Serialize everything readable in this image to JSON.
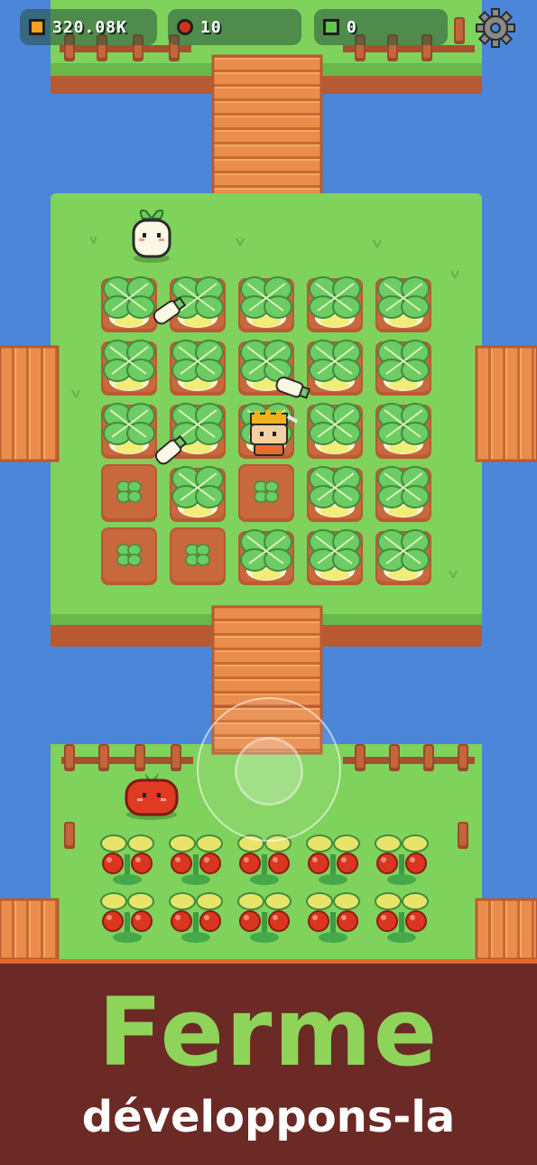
{
  "hud": {
    "coins": {
      "icon": "coin-icon",
      "value": "320.08K",
      "color": "#f2a11c"
    },
    "gems": {
      "icon": "tomato-gem-icon",
      "value": "10",
      "color": "#d3321e"
    },
    "seeds": {
      "icon": "green-gem-icon",
      "value": "0",
      "color": "#63c64c"
    },
    "settings": {
      "icon": "gear-icon"
    }
  },
  "banner": {
    "title": "Ferme",
    "subtitle": "développons-la",
    "background": "#6b2a25",
    "title_color": "#8ed45a"
  },
  "farm": {
    "turnip_field": {
      "rows": [
        [
          "turnip",
          "turnip",
          "turnip",
          "turnip",
          "turnip"
        ],
        [
          "turnip",
          "turnip",
          "turnip",
          "turnip",
          "turnip"
        ],
        [
          "turnip",
          "turnip",
          "turnip",
          "turnip",
          "turnip"
        ],
        [
          "sprout",
          "turnip",
          "sprout",
          "turnip",
          "turnip"
        ],
        [
          "sprout",
          "sprout",
          "turnip",
          "turnip",
          "turnip"
        ]
      ]
    },
    "tomato_field": {
      "rows": [
        [
          "tomato",
          "tomato",
          "tomato",
          "tomato",
          "tomato"
        ],
        [
          "tomato",
          "tomato",
          "tomato",
          "tomato",
          "tomato"
        ]
      ]
    },
    "colors": {
      "water": "#4b86d8",
      "grass": "#7fd25b",
      "soil": "#c8623a",
      "bridge": "#e98a4a",
      "leaf": "#68c860"
    }
  },
  "joystick": {
    "icon": "joystick-icon"
  }
}
